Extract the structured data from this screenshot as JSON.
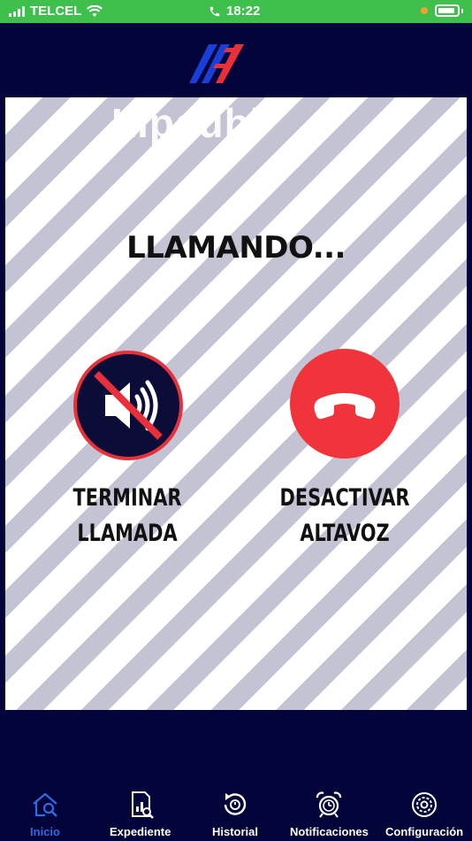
{
  "status_bar": {
    "carrier": "TELCEL",
    "time": "18:22"
  },
  "main": {
    "watermark": "Lipaubl",
    "calling_text": "LLAMANDO...",
    "left_button_label_line1": "TERMINAR",
    "left_button_label_line2": "LLAMADA",
    "right_button_label_line1": "DESACTIVAR",
    "right_button_label_line2": "ALTAVOZ"
  },
  "tabs": [
    {
      "label": "Inicio",
      "icon": "home-search-icon",
      "active": true
    },
    {
      "label": "Expediente",
      "icon": "document-chart-icon",
      "active": false
    },
    {
      "label": "Historial",
      "icon": "history-icon",
      "active": false
    },
    {
      "label": "Notificaciones",
      "icon": "alarm-clock-icon",
      "active": false
    },
    {
      "label": "Configuración",
      "icon": "gear-icon",
      "active": false
    }
  ],
  "colors": {
    "status_bar": "#3fc04c",
    "background": "#03043a",
    "hangup": "#f1343c",
    "active_tab": "#2f6be0"
  }
}
